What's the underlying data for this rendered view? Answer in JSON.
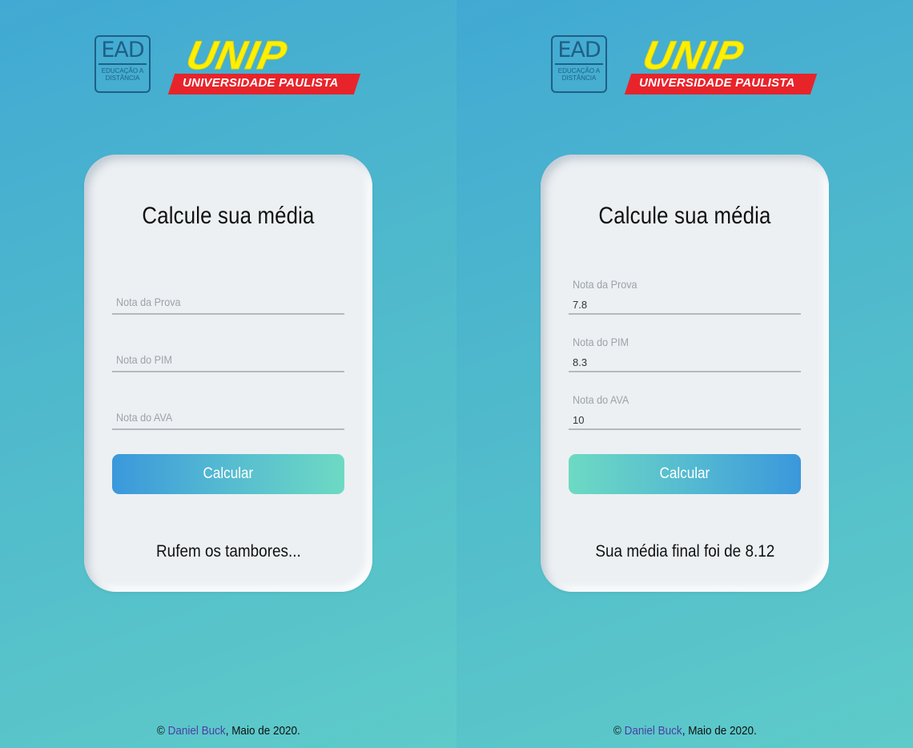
{
  "screens": [
    {
      "logo": {
        "ead_text": "EAD",
        "ead_subtitle": "EDUCAÇÃO A DISTÂNCIA",
        "unip_text": "UNIP",
        "unip_subtitle": "UNIVERSIDADE PAULISTA"
      },
      "card": {
        "title": "Calcule sua média",
        "fields": [
          {
            "label": "Nota da Prova",
            "value": ""
          },
          {
            "label": "Nota do PIM",
            "value": ""
          },
          {
            "label": "Nota do AVA",
            "value": ""
          }
        ],
        "button_label": "Calcular",
        "result_text": "Rufem os tambores..."
      },
      "footer": {
        "copyright": "©",
        "author": "Daniel Buck",
        "date": ", Maio de 2020."
      }
    },
    {
      "logo": {
        "ead_text": "EAD",
        "ead_subtitle": "EDUCAÇÃO A DISTÂNCIA",
        "unip_text": "UNIP",
        "unip_subtitle": "UNIVERSIDADE PAULISTA"
      },
      "card": {
        "title": "Calcule sua média",
        "fields": [
          {
            "label": "Nota da Prova",
            "value": "7.8"
          },
          {
            "label": "Nota do PIM",
            "value": "8.3"
          },
          {
            "label": "Nota do AVA",
            "value": "10"
          }
        ],
        "button_label": "Calcular",
        "result_text": "Sua média final foi de 8.12"
      },
      "footer": {
        "copyright": "©",
        "author": "Daniel Buck",
        "date": ", Maio de 2020."
      }
    }
  ],
  "colors": {
    "background_start": "#41a9d3",
    "background_end": "#5ecbc9",
    "card": "#ecf0f3",
    "button_blue": "#3a98db",
    "button_teal": "#6ddac3",
    "unip_yellow": "#ffef00",
    "unip_red": "#e8242b",
    "ead_blue": "#1f5f86",
    "link": "#4d3fa3"
  }
}
